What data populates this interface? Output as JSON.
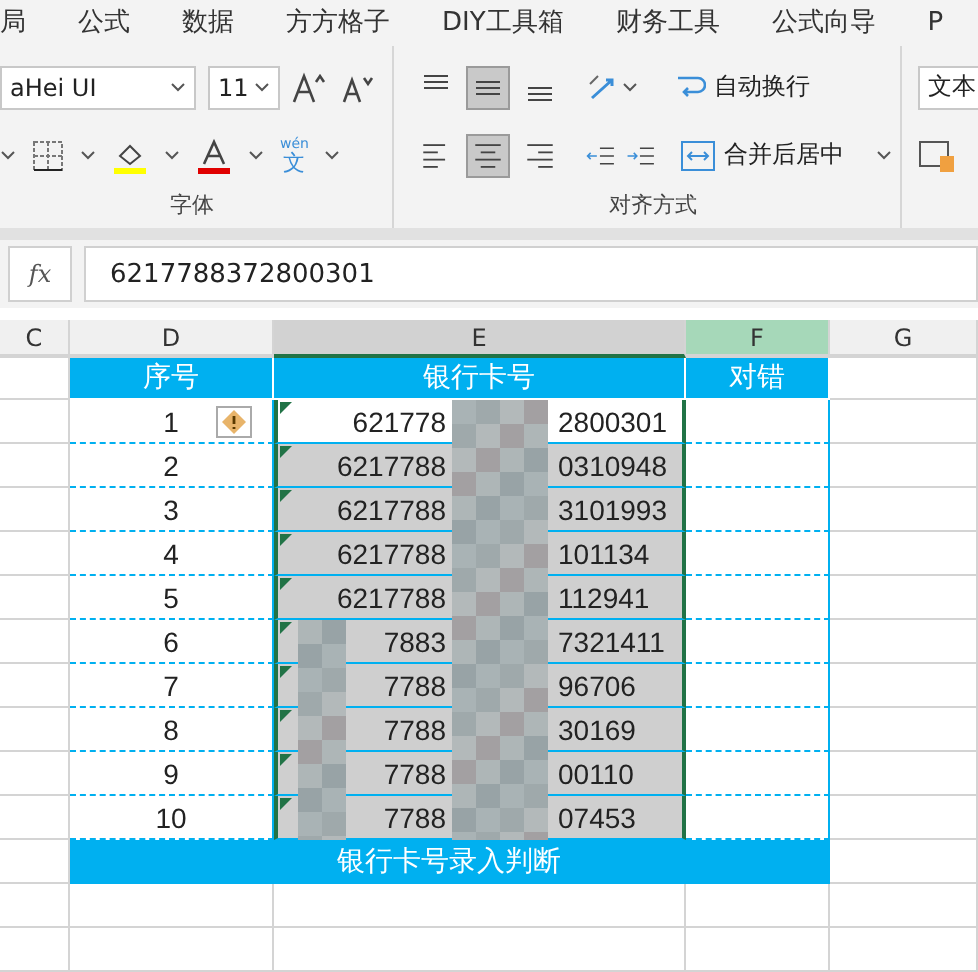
{
  "ribbon_tabs": [
    "局",
    "公式",
    "数据",
    "方方格子",
    "DIY工具箱",
    "财务工具",
    "公式向导",
    "P"
  ],
  "font_group": {
    "font_name": "aHei UI",
    "font_size": "11",
    "label": "字体",
    "phonetic": {
      "pinyin": "wén",
      "char": "文"
    }
  },
  "alignment_group": {
    "label": "对齐方式",
    "vertical": [
      {
        "kind": "top",
        "selected": false
      },
      {
        "kind": "middle",
        "selected": true
      },
      {
        "kind": "bottom",
        "selected": false
      }
    ],
    "horizontal": [
      {
        "kind": "left",
        "selected": false
      },
      {
        "kind": "center",
        "selected": true
      },
      {
        "kind": "right",
        "selected": false
      }
    ],
    "wrap_text": "自动换行",
    "merge_center": "合并后居中"
  },
  "number_group": {
    "format": "文本"
  },
  "formula_bar": {
    "function_label": "fx",
    "value": "6217788372800301"
  },
  "columns": [
    {
      "label": "C",
      "selected": false,
      "highlighted": false
    },
    {
      "label": "D",
      "selected": false,
      "highlighted": false
    },
    {
      "label": "E",
      "selected": true,
      "highlighted": false
    },
    {
      "label": "F",
      "selected": false,
      "highlighted": true
    },
    {
      "label": "G",
      "selected": false,
      "highlighted": false
    }
  ],
  "table": {
    "headers": [
      "序号",
      "银行卡号",
      "对错"
    ],
    "footer": "银行卡号录入判断",
    "rows": [
      {
        "index": "1",
        "card_start": "621778",
        "card_end": "2800301",
        "selected": false,
        "warning": true,
        "flagged": true
      },
      {
        "index": "2",
        "card_start": "6217788",
        "card_end": "0310948",
        "selected": true,
        "warning": false,
        "flagged": true
      },
      {
        "index": "3",
        "card_start": "6217788",
        "card_end": "3101993",
        "selected": true,
        "warning": false,
        "flagged": true
      },
      {
        "index": "4",
        "card_start": "6217788",
        "card_end": "101134",
        "selected": true,
        "warning": false,
        "flagged": true
      },
      {
        "index": "5",
        "card_start": "6217788",
        "card_end": "112941",
        "selected": true,
        "warning": false,
        "flagged": true
      },
      {
        "index": "6",
        "card_start": "7883",
        "card_end": "7321411",
        "selected": true,
        "warning": false,
        "flagged": true
      },
      {
        "index": "7",
        "card_start": "7788",
        "card_end": "96706",
        "selected": true,
        "warning": false,
        "flagged": true
      },
      {
        "index": "8",
        "card_start": "7788",
        "card_end": "30169",
        "selected": true,
        "warning": false,
        "flagged": true
      },
      {
        "index": "9",
        "card_start": "7788",
        "card_end": "00110",
        "selected": true,
        "warning": false,
        "flagged": true
      },
      {
        "index": "10",
        "card_start": "7788",
        "card_end": "07453",
        "selected": true,
        "warning": false,
        "flagged": true
      }
    ]
  }
}
